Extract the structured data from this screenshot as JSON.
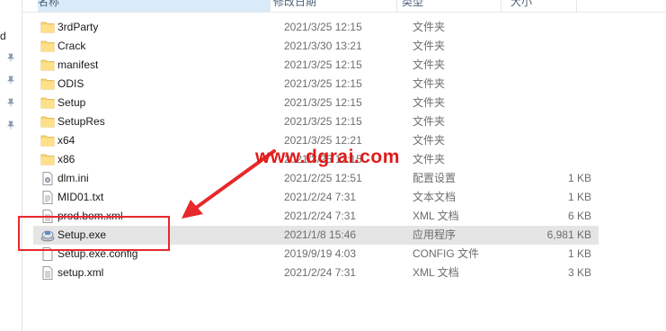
{
  "nav": {
    "letter": "d"
  },
  "header": {
    "name": "名称",
    "date": "修改日期",
    "type": "类型",
    "size": "大小"
  },
  "files": [
    {
      "name": "3rdParty",
      "date": "2021/3/25 12:15",
      "type": "文件夹",
      "size": "",
      "icon": "folder-icon"
    },
    {
      "name": "Crack",
      "date": "2021/3/30 13:21",
      "type": "文件夹",
      "size": "",
      "icon": "folder-icon"
    },
    {
      "name": "manifest",
      "date": "2021/3/25 12:15",
      "type": "文件夹",
      "size": "",
      "icon": "folder-icon"
    },
    {
      "name": "ODIS",
      "date": "2021/3/25 12:15",
      "type": "文件夹",
      "size": "",
      "icon": "folder-icon"
    },
    {
      "name": "Setup",
      "date": "2021/3/25 12:15",
      "type": "文件夹",
      "size": "",
      "icon": "folder-icon"
    },
    {
      "name": "SetupRes",
      "date": "2021/3/25 12:15",
      "type": "文件夹",
      "size": "",
      "icon": "folder-icon"
    },
    {
      "name": "x64",
      "date": "2021/3/25 12:21",
      "type": "文件夹",
      "size": "",
      "icon": "folder-icon"
    },
    {
      "name": "x86",
      "date": "2021/3/25 12:15",
      "type": "文件夹",
      "size": "",
      "icon": "folder-icon"
    },
    {
      "name": "dlm.ini",
      "date": "2021/2/25 12:51",
      "type": "配置设置",
      "size": "1 KB",
      "icon": "settings-file-icon"
    },
    {
      "name": "MID01.txt",
      "date": "2021/2/24 7:31",
      "type": "文本文档",
      "size": "1 KB",
      "icon": "text-file-icon"
    },
    {
      "name": "prod.bom.xml",
      "date": "2021/2/24 7:31",
      "type": "XML 文档",
      "size": "6 KB",
      "icon": "xml-file-icon"
    },
    {
      "name": "Setup.exe",
      "date": "2021/1/8 15:46",
      "type": "应用程序",
      "size": "6,981 KB",
      "icon": "installer-icon",
      "selected": true
    },
    {
      "name": "Setup.exe.config",
      "date": "2019/9/19 4:03",
      "type": "CONFIG 文件",
      "size": "1 KB",
      "icon": "config-file-icon"
    },
    {
      "name": "setup.xml",
      "date": "2021/2/24 7:31",
      "type": "XML 文档",
      "size": "3 KB",
      "icon": "xml-file-icon"
    }
  ],
  "watermark": "www.dgrai.com",
  "colors": {
    "selection": "#e5e5e5",
    "header_highlight": "#d9ebf9",
    "folder": "#f8d775",
    "annotation": "#e8282b"
  }
}
